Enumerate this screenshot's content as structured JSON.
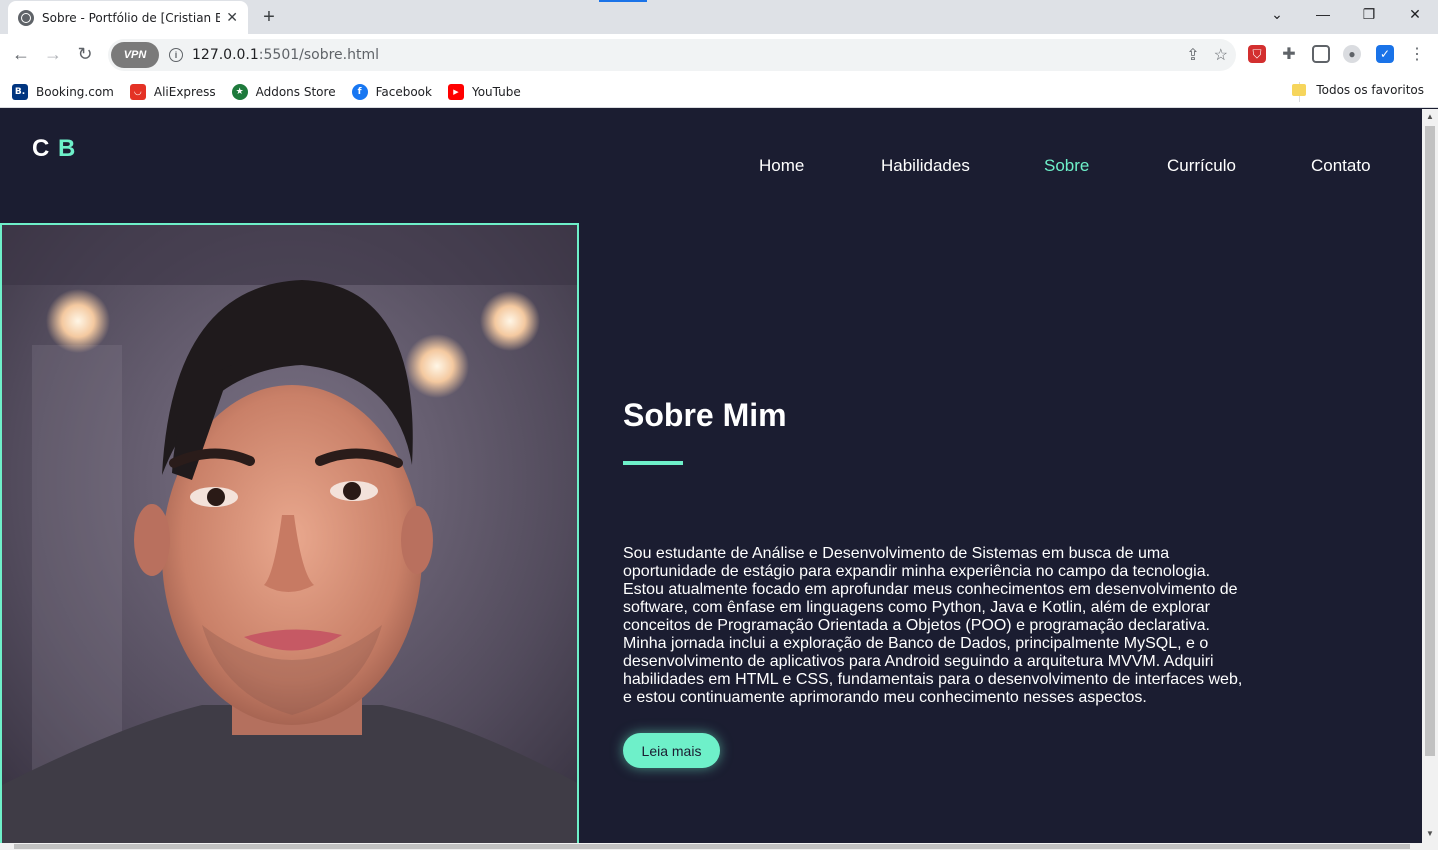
{
  "browser": {
    "tab_title": "Sobre - Portfólio de [Cristian Bru",
    "tab_close": "✕",
    "new_tab": "+",
    "url_host": "127.0.0.1",
    "url_path": ":5501/sobre.html",
    "vpn_label": "VPN",
    "window_controls": [
      "⌄",
      "—",
      "❐",
      "✕"
    ]
  },
  "bookmarks": {
    "items": [
      {
        "label": "Booking.com",
        "icon": "booking-icon",
        "color": "#003580",
        "glyph": "B."
      },
      {
        "label": "AliExpress",
        "icon": "aliexpress-icon",
        "color": "#e43225",
        "glyph": "◡"
      },
      {
        "label": "Addons Store",
        "icon": "addons-icon",
        "color": "#1e7a3c",
        "glyph": "★"
      },
      {
        "label": "Facebook",
        "icon": "facebook-icon",
        "color": "#1877f2",
        "glyph": "f"
      },
      {
        "label": "YouTube",
        "icon": "youtube-icon",
        "color": "#ff0000",
        "glyph": "▶"
      }
    ],
    "all_favorites": "Todos os favoritos"
  },
  "site": {
    "logo_c": "C",
    "logo_b": "B",
    "nav": [
      {
        "label": "Home",
        "active": false
      },
      {
        "label": "Habilidades",
        "active": false
      },
      {
        "label": "Sobre",
        "active": true
      },
      {
        "label": "Currículo",
        "active": false
      },
      {
        "label": "Contato",
        "active": false
      }
    ],
    "heading": "Sobre Mim",
    "paragraph_lines": [
      "Sou estudante de Análise e Desenvolvimento de Sistemas em busca de uma",
      "oportunidade de estágio para expandir minha experiência no campo da tecnologia.",
      "Estou atualmente focado em aprofundar meus conhecimentos em desenvolvimento de",
      "software, com ênfase em linguagens como Python, Java e Kotlin, além de explorar",
      "conceitos de Programação Orientada a Objetos (POO) e programação declarativa.",
      "Minha jornada inclui a exploração de Banco de Dados, principalmente MySQL, e o",
      "desenvolvimento de aplicativos para Android seguindo a arquitetura MVVM. Adquiri",
      "habilidades em HTML e CSS, fundamentais para o desenvolvimento de interfaces web,",
      "e estou continuamente aprimorando meu conhecimento nesses aspectos."
    ],
    "button": "Leia mais",
    "accent": "#6ef0c9",
    "background": "#1b1d31"
  }
}
